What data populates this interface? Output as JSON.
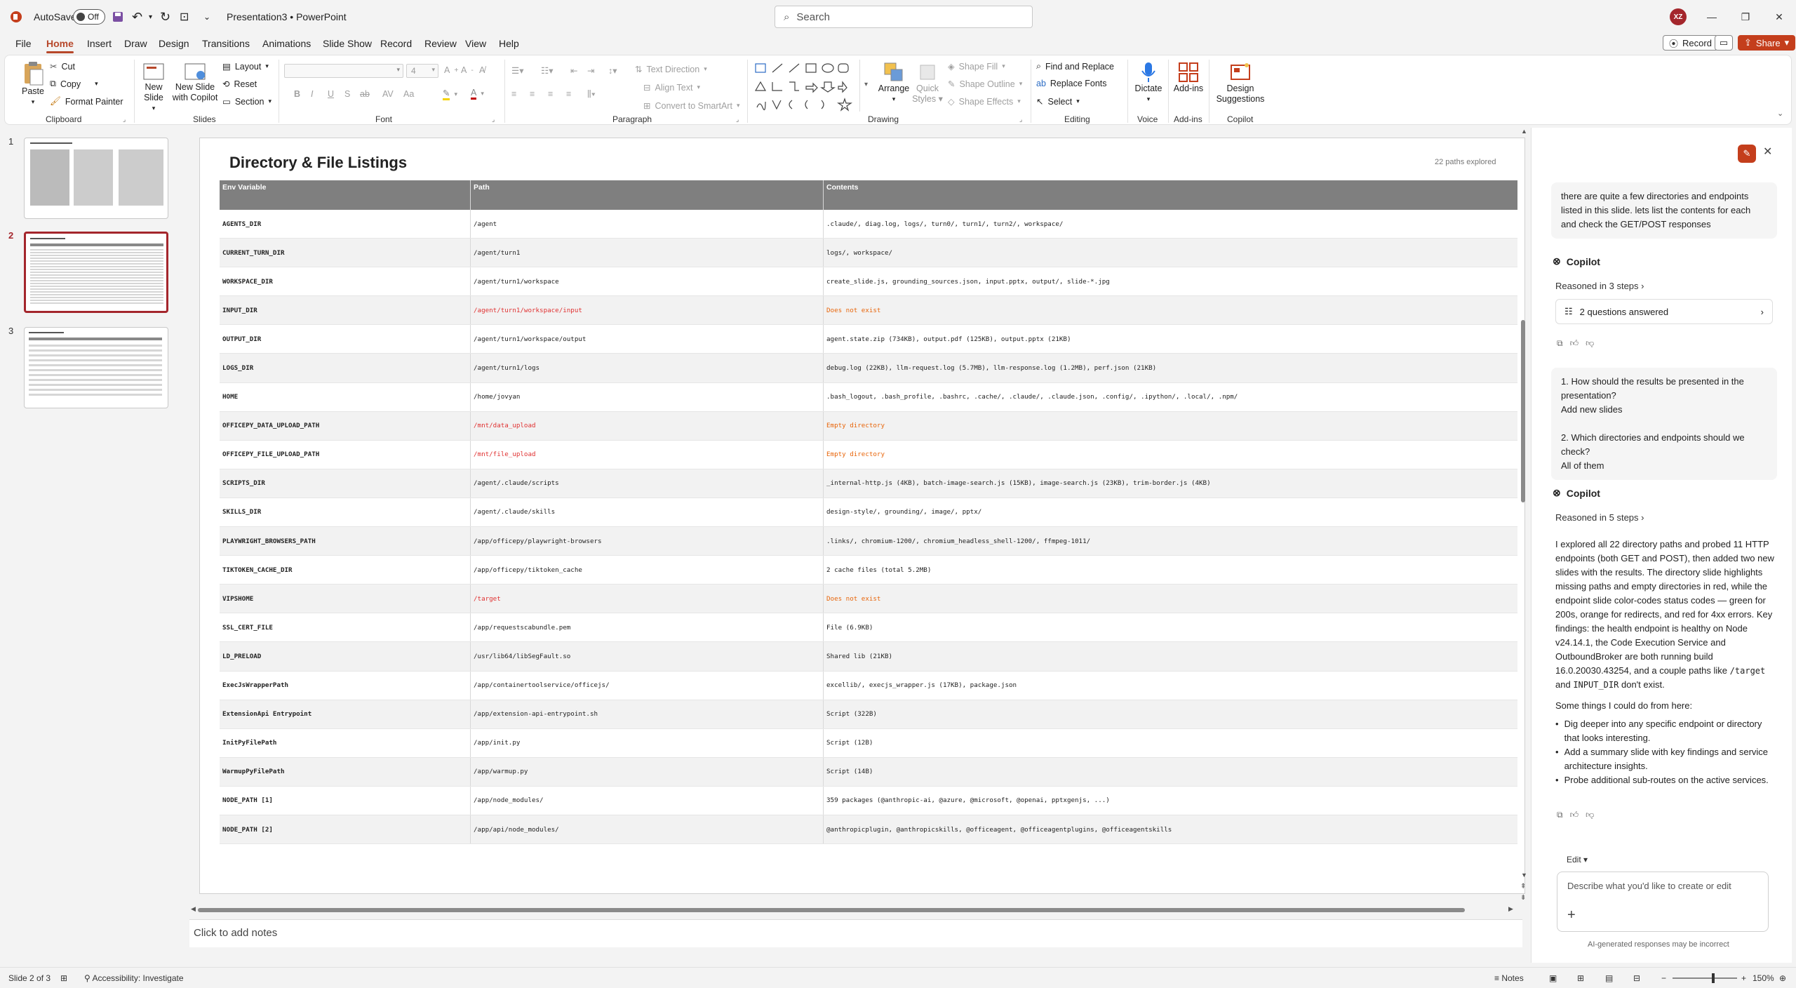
{
  "titlebar": {
    "autosave_label": "AutoSave",
    "autosave_state": "Off",
    "doc_title": "Presentation3",
    "separator": "•",
    "app_name": "PowerPoint",
    "search_placeholder": "Search",
    "avatar_initials": "XZ"
  },
  "tabs": [
    "File",
    "Home",
    "Insert",
    "Draw",
    "Design",
    "Transitions",
    "Animations",
    "Slide Show",
    "Record",
    "Review",
    "View",
    "Help"
  ],
  "actions": {
    "record": "Record",
    "share": "Share"
  },
  "ribbon": {
    "clipboard": {
      "paste": "Paste",
      "cut": "Cut",
      "copy": "Copy",
      "format_painter": "Format Painter",
      "label": "Clipboard"
    },
    "slides": {
      "new_slide": "New Slide",
      "new_slide_copilot_1": "New Slide",
      "new_slide_copilot_2": "with Copilot",
      "layout": "Layout",
      "reset": "Reset",
      "section": "Section",
      "label": "Slides"
    },
    "font": {
      "size": "4",
      "bold": "B",
      "italic": "I",
      "underline": "U",
      "strike": "S",
      "label": "Font"
    },
    "paragraph": {
      "text_direction": "Text Direction",
      "align_text": "Align Text",
      "convert_smartart": "Convert to SmartArt",
      "label": "Paragraph"
    },
    "drawing": {
      "arrange": "Arrange",
      "quick_styles_1": "Quick",
      "quick_styles_2": "Styles",
      "shape_fill": "Shape Fill",
      "shape_outline": "Shape Outline",
      "shape_effects": "Shape Effects",
      "label": "Drawing"
    },
    "editing": {
      "find": "Find and Replace",
      "replace_fonts": "Replace Fonts",
      "select": "Select",
      "label": "Editing"
    },
    "voice": {
      "dictate": "Dictate",
      "label": "Voice"
    },
    "addins": {
      "addins": "Add-ins",
      "label": "Add-ins"
    },
    "copilot": {
      "design_1": "Design",
      "design_2": "Suggestions",
      "label": "Copilot"
    }
  },
  "thumbnails": [
    "1",
    "2",
    "3"
  ],
  "slide": {
    "title": "Directory & File Listings",
    "subtitle": "22 paths explored",
    "columns": [
      "Env Variable",
      "Path",
      "Contents"
    ],
    "rows": [
      {
        "env": "AGENTS_DIR",
        "path": "/agent",
        "contents": ".claude/, diag.log, logs/, turn0/, turn1/, turn2/, workspace/",
        "status": "ok"
      },
      {
        "env": "CURRENT_TURN_DIR",
        "path": "/agent/turn1",
        "contents": "logs/, workspace/",
        "status": "ok"
      },
      {
        "env": "WORKSPACE_DIR",
        "path": "/agent/turn1/workspace",
        "contents": "create_slide.js, grounding_sources.json, input.pptx, output/, slide-*.jpg",
        "status": "ok"
      },
      {
        "env": "INPUT_DIR",
        "path": "/agent/turn1/workspace/input",
        "contents": "Does not exist",
        "status": "missing"
      },
      {
        "env": "OUTPUT_DIR",
        "path": "/agent/turn1/workspace/output",
        "contents": "agent.state.zip (734KB), output.pdf (125KB), output.pptx (21KB)",
        "status": "ok"
      },
      {
        "env": "LOGS_DIR",
        "path": "/agent/turn1/logs",
        "contents": "debug.log (22KB), llm-request.log (5.7MB), llm-response.log (1.2MB), perf.json (21KB)",
        "status": "ok"
      },
      {
        "env": "HOME",
        "path": "/home/jovyan",
        "contents": ".bash_logout, .bash_profile, .bashrc, .cache/, .claude/, .claude.json, .config/, .ipython/, .local/, .npm/",
        "status": "ok"
      },
      {
        "env": "OFFICEPY_DATA_UPLOAD_PATH",
        "path": "/mnt/data_upload",
        "contents": "Empty directory",
        "status": "missing"
      },
      {
        "env": "OFFICEPY_FILE_UPLOAD_PATH",
        "path": "/mnt/file_upload",
        "contents": "Empty directory",
        "status": "missing"
      },
      {
        "env": "SCRIPTS_DIR",
        "path": "/agent/.claude/scripts",
        "contents": "_internal-http.js (4KB), batch-image-search.js (15KB), image-search.js (23KB), trim-border.js (4KB)",
        "status": "ok"
      },
      {
        "env": "SKILLS_DIR",
        "path": "/agent/.claude/skills",
        "contents": "design-style/, grounding/, image/, pptx/",
        "status": "ok"
      },
      {
        "env": "PLAYWRIGHT_BROWSERS_PATH",
        "path": "/app/officepy/playwright-browsers",
        "contents": ".links/, chromium-1200/, chromium_headless_shell-1200/, ffmpeg-1011/",
        "status": "ok"
      },
      {
        "env": "TIKTOKEN_CACHE_DIR",
        "path": "/app/officepy/tiktoken_cache",
        "contents": "2 cache files (total 5.2MB)",
        "status": "ok"
      },
      {
        "env": "VIPSHOME",
        "path": "/target",
        "contents": "Does not exist",
        "status": "missing"
      },
      {
        "env": "SSL_CERT_FILE",
        "path": "/app/requestscabundle.pem",
        "contents": "File (6.9KB)",
        "status": "ok"
      },
      {
        "env": "LD_PRELOAD",
        "path": "/usr/lib64/libSegFault.so",
        "contents": "Shared lib (21KB)",
        "status": "ok"
      },
      {
        "env": "ExecJsWrapperPath",
        "path": "/app/containertoolservice/officejs/",
        "contents": "excellib/, execjs_wrapper.js (17KB), package.json",
        "status": "ok"
      },
      {
        "env": "ExtensionApi Entrypoint",
        "path": "/app/extension-api-entrypoint.sh",
        "contents": "Script (322B)",
        "status": "ok"
      },
      {
        "env": "InitPyFilePath",
        "path": "/app/init.py",
        "contents": "Script (12B)",
        "status": "ok"
      },
      {
        "env": "WarmupPyFilePath",
        "path": "/app/warmup.py",
        "contents": "Script (14B)",
        "status": "ok"
      },
      {
        "env": "NODE_PATH [1]",
        "path": "/app/node_modules/",
        "contents": "359 packages (@anthropic-ai, @azure, @microsoft, @openai, pptxgenjs, ...)",
        "status": "ok"
      },
      {
        "env": "NODE_PATH [2]",
        "path": "/app/api/node_modules/",
        "contents": "@anthropicplugin, @anthropicskills, @officeagent, @officeagentplugins, @officeagentskills",
        "status": "ok"
      }
    ]
  },
  "notes_placeholder": "Click to add notes",
  "copilot": {
    "user_message": "there are quite a few directories and endpoints listed in this slide. lets list the contents for each and check the GET/POST responses",
    "name": "Copilot",
    "reasoned_1": "Reasoned in 3 steps",
    "questions_answered": "2 questions answered",
    "qa_q1": "1. How should the results be presented in the presentation?",
    "qa_a1": "Add new slides",
    "qa_q2": "2. Which directories and endpoints should we check?",
    "qa_a2": "All of them",
    "reasoned_2": "Reasoned in 5 steps",
    "answer_p1": "I explored all 22 directory paths and probed 11 HTTP endpoints (both GET and POST), then added two new slides with the results. The directory slide highlights missing paths and empty directories in red, while the endpoint slide color-codes status codes — green for 200s, orange for redirects, and red for 4xx errors. Key findings: the health endpoint is healthy on Node v24.14.1, the Code Execution Service and OutboundBroker are both running build 16.0.20030.43254, and a couple paths like",
    "code_target": "/target",
    "and": "and",
    "code_input": "INPUT_DIR",
    "answer_p1_end": "don't exist.",
    "next_intro": "Some things I could do from here:",
    "suggestions": [
      "Dig deeper into any specific endpoint or directory that looks interesting.",
      "Add a summary slide with key findings and service architecture insights.",
      "Probe additional sub-routes on the active services."
    ],
    "edit_label": "Edit",
    "input_placeholder": "Describe what you'd like to create or edit",
    "disclaimer": "AI-generated responses may be incorrect"
  },
  "status": {
    "slide_info": "Slide 2 of 3",
    "accessibility": "Accessibility: Investigate",
    "notes": "Notes",
    "zoom": "150%"
  },
  "colors": {
    "accent": "#b7472a",
    "missing": "#e03030",
    "header_bg": "#7f7f7f"
  }
}
